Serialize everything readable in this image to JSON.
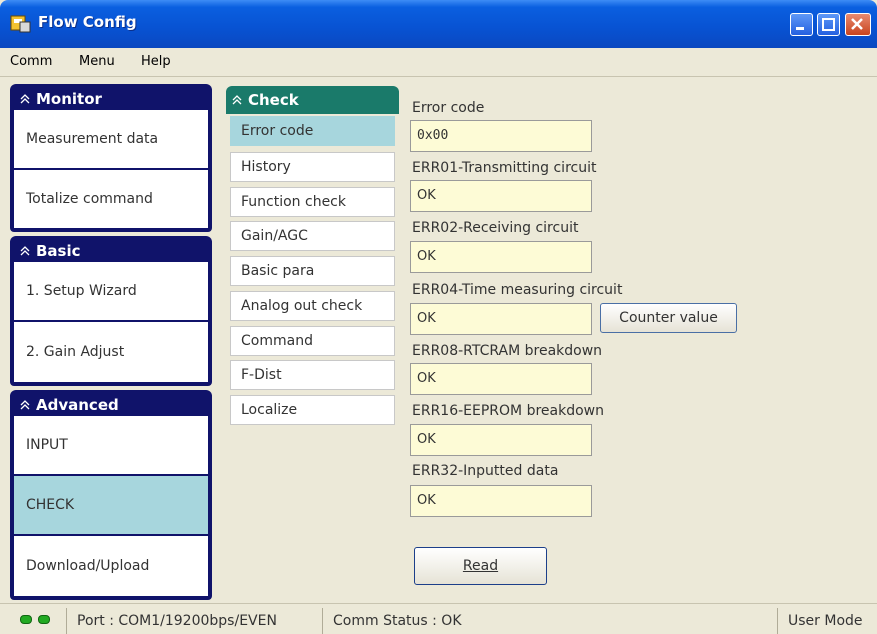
{
  "window": {
    "title": "Flow Config"
  },
  "menu": [
    "Comm",
    "Menu",
    "Help"
  ],
  "nav": {
    "monitor": {
      "header": "Monitor",
      "items": [
        "Measurement data",
        "Totalize command"
      ]
    },
    "basic": {
      "header": "Basic",
      "items": [
        "1. Setup Wizard",
        "2. Gain Adjust"
      ]
    },
    "advanced": {
      "header": "Advanced",
      "items": [
        "INPUT",
        "CHECK",
        "Download/Upload"
      ],
      "selected": "CHECK"
    }
  },
  "check_menu": {
    "header": "Check",
    "items": [
      "Error code",
      "History",
      "Function check",
      "Gain/AGC",
      "Basic para",
      "Analog out check",
      "Command",
      "F-Dist",
      "Localize"
    ],
    "selected": "Error code"
  },
  "fields": [
    {
      "label": "Error code",
      "value": "0x00"
    },
    {
      "label": "ERR01-Transmitting circuit",
      "value": "OK"
    },
    {
      "label": "ERR02-Receiving circuit",
      "value": "OK"
    },
    {
      "label": "ERR04-Time measuring circuit",
      "value": "OK"
    },
    {
      "label": "ERR08-RTCRAM breakdown",
      "value": "OK"
    },
    {
      "label": "ERR16-EEPROM breakdown",
      "value": "OK"
    },
    {
      "label": "ERR32-Inputted data",
      "value": "OK"
    }
  ],
  "buttons": {
    "counter_value": "Counter value",
    "read": "Read"
  },
  "status": {
    "port": "Port : COM1/19200bps/EVEN",
    "comm": "Comm Status : OK",
    "mode": "User Mode"
  },
  "colors": {
    "title_bar": "#0852d2",
    "nav_header": "#10136a",
    "check_header": "#1a7a6a",
    "selected": "#a7d6dd",
    "field_bg": "#fdfbd6",
    "led": "#22aa22"
  }
}
